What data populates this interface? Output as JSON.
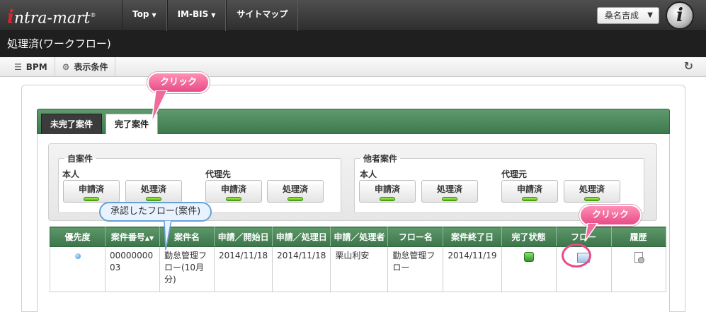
{
  "brand": {
    "logo_text": "intra-mart",
    "logo_initial": "i",
    "logo_rest": "ntra-mart",
    "logo_mark": "®"
  },
  "nav": {
    "items": [
      {
        "label": "Top",
        "caret": "▼"
      },
      {
        "label": "IM-BIS",
        "caret": "▼"
      },
      {
        "label": "サイトマップ",
        "caret": ""
      }
    ]
  },
  "user": {
    "name": "桑名吉成",
    "avatar_letter": "i"
  },
  "page": {
    "title": "処理済(ワークフロー)"
  },
  "toolbar": {
    "bpm_label": "BPM",
    "conditions_label": "表示条件"
  },
  "tabs": {
    "incomplete": "未完了案件",
    "complete": "完了案件"
  },
  "filters": {
    "own": {
      "legend": "自案件",
      "principal": {
        "label": "本人",
        "applied": "申請済",
        "processed": "処理済"
      },
      "proxy": {
        "label": "代理先",
        "applied": "申請済",
        "processed": "処理済"
      }
    },
    "others": {
      "legend": "他者案件",
      "principal": {
        "label": "本人",
        "applied": "申請済",
        "processed": "処理済"
      },
      "proxy": {
        "label": "代理元",
        "applied": "申請済",
        "processed": "処理済"
      }
    }
  },
  "table": {
    "headers": [
      "優先度",
      "案件番号",
      "案件名",
      "申請／開始日",
      "申請／処理日",
      "申請／処理者",
      "フロー名",
      "案件終了日",
      "完了状態",
      "フロー",
      "履歴"
    ],
    "sort_mark": "▲▼",
    "rows": [
      {
        "matter_no": "0000000003",
        "matter_name": "勤怠管理フロー(10月分)",
        "start_date": "2014/11/18",
        "process_date": "2014/11/18",
        "processor": "栗山利安",
        "flow_name": "勤怠管理フロー",
        "end_date": "2014/11/19"
      }
    ]
  },
  "callouts": {
    "click_tab": "クリック",
    "click_flow": "クリック",
    "approved_flow": "承認したフロー(案件)"
  }
}
